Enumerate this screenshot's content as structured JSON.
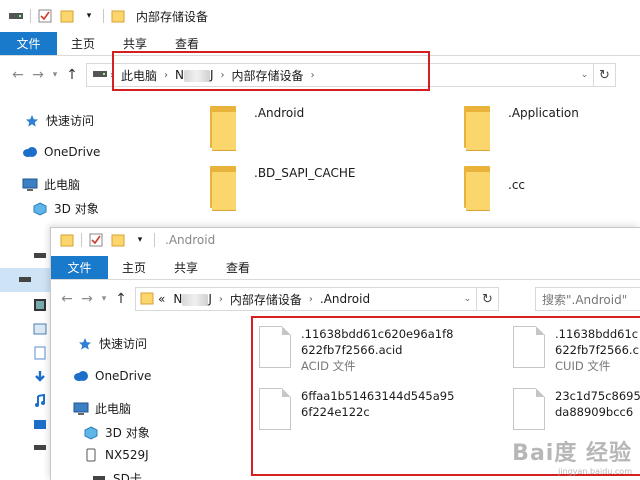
{
  "window1": {
    "title": "内部存储设备",
    "tabs": [
      "文件",
      "主页",
      "共享",
      "查看"
    ],
    "breadcrumb": [
      "此电脑",
      "N",
      "J",
      "内部存储设备"
    ],
    "sidebar": [
      "快速访问",
      "OneDrive",
      "此电脑",
      "3D 对象"
    ],
    "folders": [
      ".Android",
      ".Application",
      ".BD_SAPI_CACHE",
      ".cc"
    ]
  },
  "window2": {
    "title": ".Android",
    "tabs": [
      "文件",
      "主页",
      "共享",
      "查看"
    ],
    "breadcrumb_prefix": "«",
    "breadcrumb": [
      "N",
      "J",
      "内部存储设备",
      ".Android"
    ],
    "search_placeholder": "搜索\".Android\"",
    "sidebar": [
      "快速访问",
      "OneDrive",
      "此电脑",
      "3D 对象",
      "NX529J",
      "SD卡"
    ],
    "files": [
      {
        "name_line1": ".11638bdd61c620e96a1f8",
        "name_line2": "622fb7f2566.acid",
        "type": "ACID 文件"
      },
      {
        "name_line1": ".11638bdd61c",
        "name_line2": "622fb7f2566.c",
        "type": "CUID 文件"
      },
      {
        "name_line1": "6ffaa1b51463144d545a95",
        "name_line2": "6f224e122c",
        "type": ""
      },
      {
        "name_line1": "23c1d75c8695",
        "name_line2": "da88909bcc6",
        "type": ""
      }
    ]
  },
  "watermark": {
    "logo": "Bai度 经验",
    "url": "jingyan.baidu.com"
  },
  "colors": {
    "accent": "#1979ca",
    "highlight": "#d42020",
    "folder": "#fbd66c"
  }
}
